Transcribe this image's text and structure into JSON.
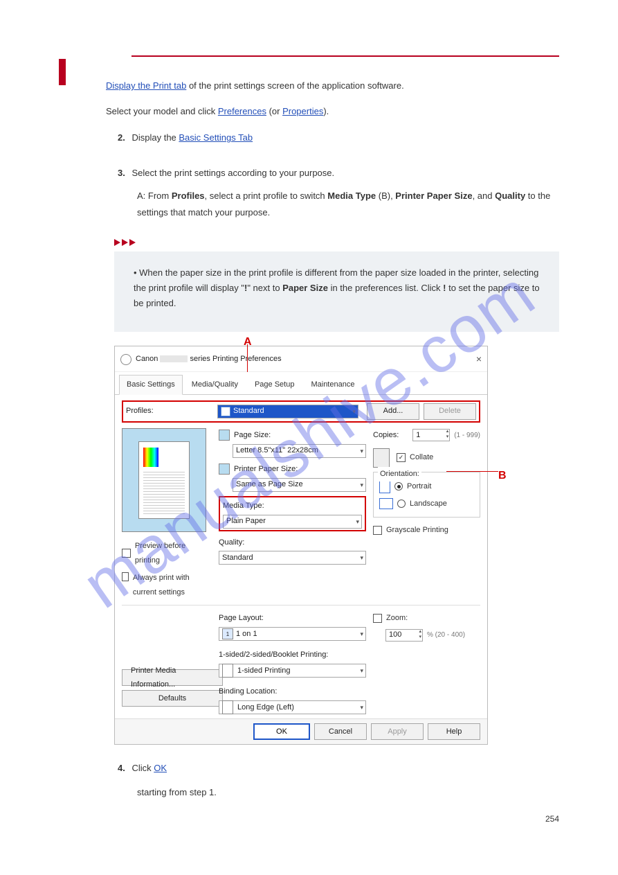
{
  "watermark": "manualshive.com",
  "intro": {
    "linkText": "Display the Print tab",
    "trail": " of the print settings screen of the application software.",
    "selectPrinter": "Select your model and click ",
    "prefs": "Preferences",
    "or": " (or ",
    "props": "Properties",
    "end": ").",
    "step2a": "Display the ",
    "basicLink": "Basic Settings Tab",
    "step4": "Select the print settings according to your purpose.",
    "step4a": "A: From ",
    "step4b": ", select a print profile to switch ",
    "step4c": " (B), ",
    "step4d": ", and ",
    "step4e": " to the settings that match your purpose.",
    "note1a": "• When the paper size in the print profile is different from the paper size loaded in the printer, selecting the print profile will display \"",
    "note1b": "\" next to ",
    "note1c": " in the preferences list. Click ",
    "note1d": " to set the paper size to be printed.",
    "step5": "Click ",
    "step5b": " starting from step 1."
  },
  "labels": {
    "profiles": "Profiles",
    "mediaType": "Media Type",
    "printerPaperSize": "Printer Paper Size",
    "quality": "Quality",
    "bang": "!",
    "paperSize": "Paper Size",
    "ok": "OK",
    "basicSettings": "Basic Settings"
  },
  "dialog": {
    "titlePrefix": "Canon",
    "titleSuffix": "series Printing Preferences",
    "tabs": [
      "Basic Settings",
      "Media/Quality",
      "Page Setup",
      "Maintenance"
    ],
    "activeTab": 0,
    "profilesLabel": "Profiles:",
    "profilesValue": "Standard",
    "addBtn": "Add...",
    "deleteBtn": "Delete",
    "pageSizeLabel": "Page Size:",
    "pageSizeValue": "Letter 8.5\"x11\" 22x28cm",
    "printerPaperSizeLabel": "Printer Paper Size:",
    "printerPaperSizeValue": "Same as Page Size",
    "mediaTypeLabel": "Media Type:",
    "mediaTypeValue": "Plain Paper",
    "qualityLabel": "Quality:",
    "qualityValue": "Standard",
    "copiesLabel": "Copies:",
    "copiesValue": "1",
    "copiesRange": "(1 - 999)",
    "collateLabel": "Collate",
    "orientationLabel": "Orientation:",
    "portrait": "Portrait",
    "landscape": "Landscape",
    "grayscale": "Grayscale Printing",
    "previewBefore": "Preview before printing",
    "alwaysPrint": "Always print with current settings",
    "pageLayoutLabel": "Page Layout:",
    "pageLayoutValue": "1 on 1",
    "zoomLabel": "Zoom:",
    "zoomValue": "100",
    "zoomRange": "% (20 - 400)",
    "sidedLabel": "1-sided/2-sided/Booklet Printing:",
    "sidedValue": "1-sided Printing",
    "bindingLabel": "Binding Location:",
    "bindingValue": "Long Edge (Left)",
    "printerMediaInfoBtn": "Printer Media Information...",
    "defaultsBtn": "Defaults",
    "okBtn": "OK",
    "cancelBtn": "Cancel",
    "applyBtn": "Apply",
    "helpBtn": "Help"
  },
  "callouts": {
    "A": "A",
    "B": "B"
  },
  "pageNumber": "254"
}
